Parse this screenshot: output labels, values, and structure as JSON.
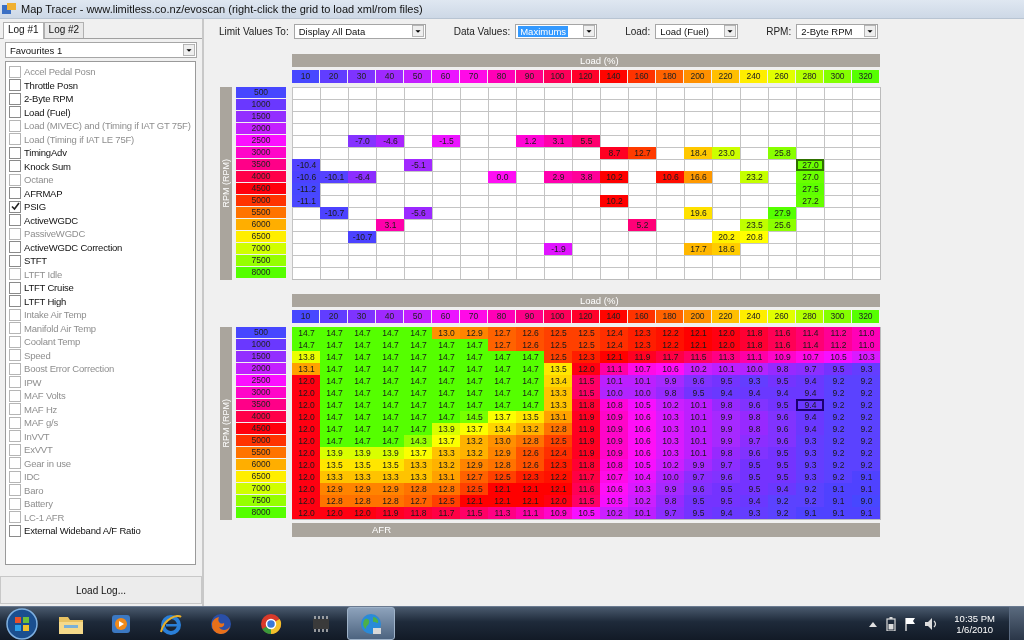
{
  "window": {
    "title": "Map Tracer - www.limitless.co.nz/evoscan (right-click the grid to load xml/rom files)"
  },
  "left_panel": {
    "tabs": [
      {
        "label": "Log #1",
        "selected": true
      },
      {
        "label": "Log #2",
        "selected": false
      }
    ],
    "favourites": {
      "value": "Favourites 1"
    },
    "items": [
      {
        "label": "Accel Pedal Posn",
        "checked": false,
        "disabled": true
      },
      {
        "label": "Throttle Posn",
        "checked": false,
        "disabled": false
      },
      {
        "label": "2-Byte RPM",
        "checked": false,
        "disabled": false
      },
      {
        "label": "Load (Fuel)",
        "checked": false,
        "disabled": false
      },
      {
        "label": "Load (MIVEC) and (Timing if IAT GT 75F)",
        "checked": false,
        "disabled": true
      },
      {
        "label": "Load (Timing if IAT LE 75F)",
        "checked": false,
        "disabled": true
      },
      {
        "label": "TimingAdv",
        "checked": false,
        "disabled": false
      },
      {
        "label": "Knock Sum",
        "checked": false,
        "disabled": false
      },
      {
        "label": "Octane",
        "checked": false,
        "disabled": true
      },
      {
        "label": "AFRMAP",
        "checked": false,
        "disabled": false
      },
      {
        "label": "PSIG",
        "checked": true,
        "disabled": false
      },
      {
        "label": "ActiveWGDC",
        "checked": false,
        "disabled": false
      },
      {
        "label": "PassiveWGDC",
        "checked": false,
        "disabled": true
      },
      {
        "label": "ActiveWGDC Correction",
        "checked": false,
        "disabled": false
      },
      {
        "label": "STFT",
        "checked": false,
        "disabled": false
      },
      {
        "label": "LTFT Idle",
        "checked": false,
        "disabled": true
      },
      {
        "label": "LTFT Cruise",
        "checked": false,
        "disabled": false
      },
      {
        "label": "LTFT High",
        "checked": false,
        "disabled": false
      },
      {
        "label": "Intake Air Temp",
        "checked": false,
        "disabled": true
      },
      {
        "label": "Manifold Air Temp",
        "checked": false,
        "disabled": true
      },
      {
        "label": "Coolant Temp",
        "checked": false,
        "disabled": true
      },
      {
        "label": "Speed",
        "checked": false,
        "disabled": true
      },
      {
        "label": "Boost Error Correction",
        "checked": false,
        "disabled": true
      },
      {
        "label": "IPW",
        "checked": false,
        "disabled": true
      },
      {
        "label": "MAF Volts",
        "checked": false,
        "disabled": true
      },
      {
        "label": "MAF Hz",
        "checked": false,
        "disabled": true
      },
      {
        "label": "MAF g/s",
        "checked": false,
        "disabled": true
      },
      {
        "label": "InVVT",
        "checked": false,
        "disabled": true
      },
      {
        "label": "ExVVT",
        "checked": false,
        "disabled": true
      },
      {
        "label": "Gear in use",
        "checked": false,
        "disabled": true
      },
      {
        "label": "IDC",
        "checked": false,
        "disabled": true
      },
      {
        "label": "Baro",
        "checked": false,
        "disabled": true
      },
      {
        "label": "Battery",
        "checked": false,
        "disabled": true
      },
      {
        "label": "LC-1 AFR",
        "checked": false,
        "disabled": true
      },
      {
        "label": "External Wideband A/F Ratio",
        "checked": false,
        "disabled": false
      }
    ],
    "load_button": "Load Log..."
  },
  "filters": [
    {
      "label": "Limit Values To:",
      "value": "Display All Data",
      "highlighted": false
    },
    {
      "label": "Data Values:",
      "value": "Maximums",
      "highlighted": true
    },
    {
      "label": "Load:",
      "value": "Load (Fuel)",
      "highlighted": false
    },
    {
      "label": "RPM:",
      "value": "2-Byte RPM",
      "highlighted": false
    }
  ],
  "grids": [
    {
      "x_title": "Load (%)",
      "y_title": "RPM (RPM)",
      "columns": [
        "10",
        "20",
        "30",
        "40",
        "50",
        "60",
        "70",
        "80",
        "90",
        "100",
        "120",
        "140",
        "160",
        "180",
        "200",
        "220",
        "240",
        "260",
        "280",
        "300",
        "320"
      ],
      "rows": [
        {
          "label": "500",
          "cells": [
            null,
            null,
            null,
            null,
            null,
            null,
            null,
            null,
            null,
            null,
            null,
            null,
            null,
            null,
            null,
            null,
            null,
            null,
            null,
            null,
            null
          ]
        },
        {
          "label": "1000",
          "cells": [
            null,
            null,
            null,
            null,
            null,
            null,
            null,
            null,
            null,
            null,
            null,
            null,
            null,
            null,
            null,
            null,
            null,
            null,
            null,
            null,
            null
          ]
        },
        {
          "label": "1500",
          "cells": [
            null,
            null,
            null,
            null,
            null,
            null,
            null,
            null,
            null,
            null,
            null,
            null,
            null,
            null,
            null,
            null,
            null,
            null,
            null,
            null,
            null
          ]
        },
        {
          "label": "2000",
          "cells": [
            null,
            null,
            null,
            null,
            null,
            null,
            null,
            null,
            null,
            null,
            null,
            null,
            null,
            null,
            null,
            null,
            null,
            null,
            null,
            null,
            null
          ]
        },
        {
          "label": "2500",
          "cells": [
            null,
            null,
            "-7.0",
            "-4.6",
            null,
            "-1.5",
            null,
            null,
            "1.2",
            "3.1",
            "5.5",
            null,
            null,
            null,
            null,
            null,
            null,
            null,
            null,
            null,
            null
          ]
        },
        {
          "label": "3000",
          "cells": [
            null,
            null,
            null,
            null,
            null,
            null,
            null,
            null,
            null,
            null,
            null,
            "8.7",
            "12.7",
            null,
            "18.4",
            "23.0",
            null,
            "25.8",
            null,
            null,
            null
          ]
        },
        {
          "label": "3500",
          "cells": [
            "-10.4",
            null,
            null,
            null,
            "-5.1",
            null,
            null,
            null,
            null,
            null,
            null,
            null,
            null,
            null,
            null,
            null,
            null,
            null,
            {
              "value": "27.0",
              "selected": true
            },
            null,
            null
          ]
        },
        {
          "label": "4000",
          "cells": [
            "-10.6",
            "-10.1",
            "-6.4",
            null,
            null,
            null,
            null,
            "0.0",
            null,
            "2.9",
            "3.8",
            "10.2",
            null,
            "10.6",
            "16.6",
            null,
            "23.2",
            null,
            "27.0",
            null,
            null
          ]
        },
        {
          "label": "4500",
          "cells": [
            "-11.2",
            null,
            null,
            null,
            null,
            null,
            null,
            null,
            null,
            null,
            null,
            null,
            null,
            null,
            null,
            null,
            null,
            null,
            "27.5",
            null,
            null
          ]
        },
        {
          "label": "5000",
          "cells": [
            "-11.1",
            null,
            null,
            null,
            null,
            null,
            null,
            null,
            null,
            null,
            null,
            "10.2",
            null,
            null,
            null,
            null,
            null,
            null,
            "27.2",
            null,
            null
          ]
        },
        {
          "label": "5500",
          "cells": [
            null,
            "-10.7",
            null,
            null,
            "-5.6",
            null,
            null,
            null,
            null,
            null,
            null,
            null,
            null,
            null,
            "19.6",
            null,
            null,
            "27.9",
            null,
            null,
            null
          ]
        },
        {
          "label": "6000",
          "cells": [
            null,
            null,
            null,
            "3.1",
            null,
            null,
            null,
            null,
            null,
            null,
            null,
            null,
            "5.2",
            null,
            null,
            null,
            "23.5",
            "25.6",
            null,
            null,
            null
          ]
        },
        {
          "label": "6500",
          "cells": [
            null,
            null,
            "-10.7",
            null,
            null,
            null,
            null,
            null,
            null,
            null,
            null,
            null,
            null,
            null,
            null,
            "20.2",
            "20.8",
            null,
            null,
            null,
            null
          ]
        },
        {
          "label": "7000",
          "cells": [
            null,
            null,
            null,
            null,
            null,
            null,
            null,
            null,
            null,
            "-1.9",
            null,
            null,
            null,
            null,
            "17.7",
            "18.6",
            null,
            null,
            null,
            null,
            null
          ]
        },
        {
          "label": "7500",
          "cells": [
            null,
            null,
            null,
            null,
            null,
            null,
            null,
            null,
            null,
            null,
            null,
            null,
            null,
            null,
            null,
            null,
            null,
            null,
            null,
            null,
            null
          ]
        },
        {
          "label": "8000",
          "cells": [
            null,
            null,
            null,
            null,
            null,
            null,
            null,
            null,
            null,
            null,
            null,
            null,
            null,
            null,
            null,
            null,
            null,
            null,
            null,
            null,
            null
          ]
        }
      ]
    },
    {
      "x_title": "Load (%)",
      "y_title": "RPM (RPM)",
      "footer_title": "AFR",
      "columns": [
        "10",
        "20",
        "30",
        "40",
        "50",
        "60",
        "70",
        "80",
        "90",
        "100",
        "120",
        "140",
        "160",
        "180",
        "200",
        "220",
        "240",
        "260",
        "280",
        "300",
        "320"
      ],
      "rows": [
        {
          "label": "500",
          "cells": [
            "14.7",
            "14.7",
            "14.7",
            "14.7",
            "14.7",
            "13.0",
            "12.9",
            "12.7",
            "12.6",
            "12.5",
            "12.5",
            "12.4",
            "12.3",
            "12.2",
            "12.1",
            "12.0",
            "11.8",
            "11.6",
            "11.4",
            "11.2",
            "11.0"
          ]
        },
        {
          "label": "1000",
          "cells": [
            "14.7",
            "14.7",
            "14.7",
            "14.7",
            "14.7",
            "14.7",
            "14.7",
            "12.7",
            "12.6",
            "12.5",
            "12.5",
            "12.4",
            "12.3",
            "12.2",
            "12.1",
            "12.0",
            "11.8",
            "11.6",
            "11.4",
            "11.2",
            "11.0"
          ]
        },
        {
          "label": "1500",
          "cells": [
            "13.8",
            "14.7",
            "14.7",
            "14.7",
            "14.7",
            "14.7",
            "14.7",
            "14.7",
            "14.7",
            "12.5",
            "12.3",
            "12.1",
            "11.9",
            "11.7",
            "11.5",
            "11.3",
            "11.1",
            "10.9",
            "10.7",
            "10.5",
            "10.3"
          ]
        },
        {
          "label": "2000",
          "cells": [
            "13.1",
            "14.7",
            "14.7",
            "14.7",
            "14.7",
            "14.7",
            "14.7",
            "14.7",
            "14.7",
            "13.5",
            "12.0",
            "11.1",
            "10.7",
            "10.6",
            "10.2",
            "10.1",
            "10.0",
            "9.8",
            "9.7",
            "9.5",
            "9.3"
          ]
        },
        {
          "label": "2500",
          "cells": [
            "12.0",
            "14.7",
            "14.7",
            "14.7",
            "14.7",
            "14.7",
            "14.7",
            "14.7",
            "14.7",
            "13.4",
            "11.5",
            "10.1",
            "10.1",
            "9.9",
            "9.6",
            "9.5",
            "9.3",
            "9.5",
            "9.4",
            "9.2",
            "9.2"
          ]
        },
        {
          "label": "3000",
          "cells": [
            "12.0",
            "14.7",
            "14.7",
            "14.7",
            "14.7",
            "14.7",
            "14.7",
            "14.7",
            "14.7",
            "13.3",
            "11.5",
            "10.0",
            "10.0",
            "9.8",
            "9.5",
            "9.4",
            "9.4",
            "9.4",
            "9.4",
            "9.2",
            "9.2"
          ]
        },
        {
          "label": "3500",
          "cells": [
            "12.0",
            "14.7",
            "14.7",
            "14.7",
            "14.7",
            "14.7",
            "14.7",
            "14.7",
            "14.7",
            "13.3",
            "11.8",
            "10.8",
            "10.5",
            "10.2",
            "10.1",
            "9.8",
            "9.6",
            "9.5",
            {
              "value": "9.4",
              "selected": true
            },
            "9.2",
            "9.2"
          ]
        },
        {
          "label": "4000",
          "cells": [
            "12.0",
            "14.7",
            "14.7",
            "14.7",
            "14.7",
            "14.7",
            "14.5",
            "13.7",
            "13.5",
            "13.1",
            "11.9",
            "10.9",
            "10.6",
            "10.3",
            "10.1",
            "9.9",
            "9.8",
            "9.6",
            "9.4",
            "9.2",
            "9.2"
          ]
        },
        {
          "label": "4500",
          "cells": [
            "12.0",
            "14.7",
            "14.7",
            "14.7",
            "14.7",
            "13.9",
            "13.7",
            "13.4",
            "13.2",
            "12.8",
            "11.9",
            "10.9",
            "10.6",
            "10.3",
            "10.1",
            "9.9",
            "9.8",
            "9.6",
            "9.4",
            "9.2",
            "9.2"
          ]
        },
        {
          "label": "5000",
          "cells": [
            "12.0",
            "14.7",
            "14.7",
            "14.7",
            "14.3",
            "13.7",
            "13.2",
            "13.0",
            "12.8",
            "12.5",
            "11.9",
            "10.9",
            "10.6",
            "10.3",
            "10.1",
            "9.9",
            "9.7",
            "9.6",
            "9.3",
            "9.2",
            "9.2"
          ]
        },
        {
          "label": "5500",
          "cells": [
            "12.0",
            "13.9",
            "13.9",
            "13.9",
            "13.7",
            "13.3",
            "13.2",
            "12.9",
            "12.6",
            "12.4",
            "11.9",
            "10.9",
            "10.6",
            "10.3",
            "10.1",
            "9.8",
            "9.6",
            "9.5",
            "9.3",
            "9.2",
            "9.2"
          ]
        },
        {
          "label": "6000",
          "cells": [
            "12.0",
            "13.5",
            "13.5",
            "13.5",
            "13.3",
            "13.2",
            "12.9",
            "12.8",
            "12.6",
            "12.3",
            "11.8",
            "10.8",
            "10.5",
            "10.2",
            "9.9",
            "9.7",
            "9.5",
            "9.5",
            "9.3",
            "9.2",
            "9.2"
          ]
        },
        {
          "label": "6500",
          "cells": [
            "12.0",
            "13.3",
            "13.3",
            "13.3",
            "13.3",
            "13.1",
            "12.7",
            "12.5",
            "12.3",
            "12.2",
            "11.7",
            "10.7",
            "10.4",
            "10.0",
            "9.7",
            "9.6",
            "9.5",
            "9.5",
            "9.3",
            "9.2",
            "9.1"
          ]
        },
        {
          "label": "7000",
          "cells": [
            "12.0",
            "12.9",
            "12.9",
            "12.9",
            "12.8",
            "12.8",
            "12.5",
            "12.1",
            "12.1",
            "12.1",
            "11.6",
            "10.6",
            "10.3",
            "9.9",
            "9.6",
            "9.5",
            "9.5",
            "9.4",
            "9.2",
            "9.1",
            "9.1"
          ]
        },
        {
          "label": "7500",
          "cells": [
            "12.0",
            "12.8",
            "12.8",
            "12.8",
            "12.7",
            "12.5",
            "12.1",
            "12.1",
            "12.1",
            "12.0",
            "11.5",
            "10.5",
            "10.2",
            "9.8",
            "9.5",
            "9.5",
            "9.4",
            "9.2",
            "9.2",
            "9.1",
            "9.0"
          ]
        },
        {
          "label": "8000",
          "cells": [
            "12.0",
            "12.0",
            "12.0",
            "11.9",
            "11.8",
            "11.7",
            "11.5",
            "11.3",
            "11.1",
            "10.9",
            "10.5",
            "10.2",
            "10.1",
            "9.7",
            "9.5",
            "9.4",
            "9.3",
            "9.2",
            "9.1",
            "9.1",
            "9.1"
          ]
        }
      ]
    }
  ],
  "taskbar": {
    "apps": [
      {
        "kind": "folder",
        "active": false
      },
      {
        "kind": "media",
        "active": false
      },
      {
        "kind": "ie",
        "active": false
      },
      {
        "kind": "firefox",
        "active": false
      },
      {
        "kind": "chrome",
        "active": false
      },
      {
        "kind": "chip",
        "active": false
      },
      {
        "kind": "globe",
        "active": true
      }
    ],
    "time": "10:35 PM",
    "date": "1/6/2010"
  }
}
